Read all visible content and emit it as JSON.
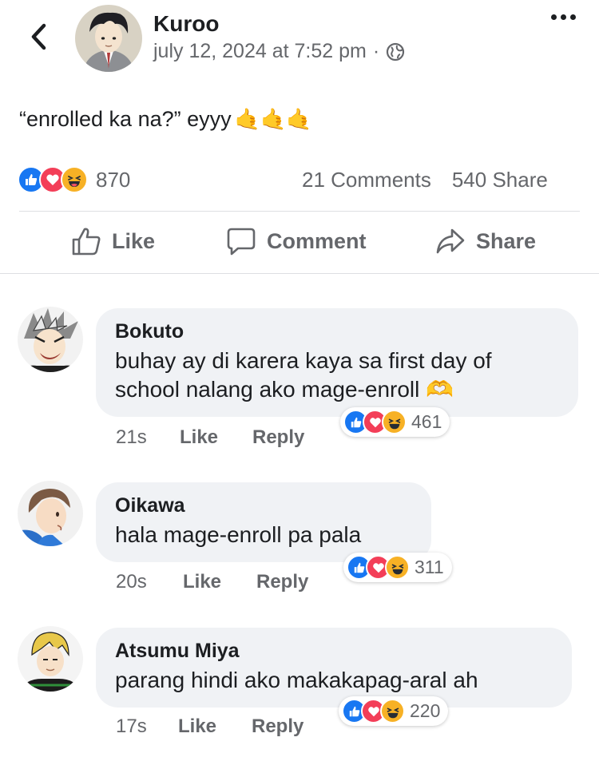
{
  "post": {
    "author": "Kuroo",
    "timestamp": "july 12, 2024 at 7:52 pm",
    "separator": "·",
    "privacy_icon": "globe-icon",
    "text": "“enrolled ka na?” eyyy",
    "text_emoji": "🤙🤙🤙",
    "reaction_count": "870",
    "comments_count": "21 Comments",
    "shares_count": "540 Share"
  },
  "actions": {
    "like": "Like",
    "comment": "Comment",
    "share": "Share"
  },
  "comments": [
    {
      "name": "Bokuto",
      "text": "buhay ay di karera kaya sa first day of school nalang ako mage-enroll 🫶",
      "time": "21s",
      "like": "Like",
      "reply": "Reply",
      "reactions": "461"
    },
    {
      "name": "Oikawa",
      "text": "hala mage-enroll pa pala",
      "time": "20s",
      "like": "Like",
      "reply": "Reply",
      "reactions": "311"
    },
    {
      "name": "Atsumu Miya",
      "text": "parang hindi ako makakapag-aral ah",
      "time": "17s",
      "like": "Like",
      "reply": "Reply",
      "reactions": "220"
    }
  ],
  "colors": {
    "like_blue": "#1877f2",
    "love_red": "#f33e58",
    "haha_yellow": "#f7b125",
    "bubble_gray": "#f0f2f5",
    "secondary_text": "#65676b"
  }
}
